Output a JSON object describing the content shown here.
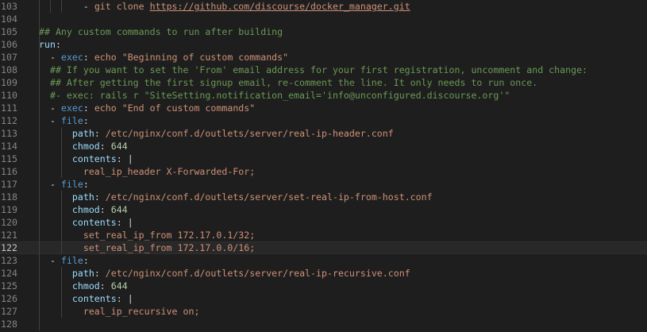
{
  "editor": {
    "lines": [
      {
        "n": "103",
        "parts": [
          [
            "op",
            "        - "
          ],
          [
            "str",
            "git clone "
          ],
          [
            "url",
            "https://github.com/discourse/docker_manager.git"
          ]
        ]
      },
      {
        "n": "104",
        "parts": []
      },
      {
        "n": "105",
        "parts": [
          [
            "cmt",
            "## Any custom commands to run after building"
          ]
        ]
      },
      {
        "n": "106",
        "parts": [
          [
            "prop",
            "run"
          ],
          [
            "op",
            ":"
          ]
        ]
      },
      {
        "n": "107",
        "parts": [
          [
            "op",
            "  - "
          ],
          [
            "key",
            "exec"
          ],
          [
            "op",
            ": "
          ],
          [
            "str",
            "echo \"Beginning of custom commands\""
          ]
        ]
      },
      {
        "n": "108",
        "parts": [
          [
            "cmt",
            "  ## If you want to set the 'From' email address for your first registration, uncomment and change:"
          ]
        ]
      },
      {
        "n": "109",
        "parts": [
          [
            "cmt",
            "  ## After getting the first signup email, re-comment the line. It only needs to run once."
          ]
        ]
      },
      {
        "n": "110",
        "parts": [
          [
            "cmt",
            "  #- exec: rails r \"SiteSetting.notification_email='info@unconfigured.discourse.org'\""
          ]
        ]
      },
      {
        "n": "111",
        "parts": [
          [
            "op",
            "  - "
          ],
          [
            "key",
            "exec"
          ],
          [
            "op",
            ": "
          ],
          [
            "str",
            "echo \"End of custom commands\""
          ]
        ]
      },
      {
        "n": "112",
        "parts": [
          [
            "op",
            "  - "
          ],
          [
            "key",
            "file"
          ],
          [
            "op",
            ":"
          ]
        ]
      },
      {
        "n": "113",
        "parts": [
          [
            "op",
            "      "
          ],
          [
            "prop",
            "path"
          ],
          [
            "op",
            ": "
          ],
          [
            "str",
            "/etc/nginx/conf.d/outlets/server/real-ip-header.conf"
          ]
        ]
      },
      {
        "n": "114",
        "parts": [
          [
            "op",
            "      "
          ],
          [
            "prop",
            "chmod"
          ],
          [
            "op",
            ": "
          ],
          [
            "num",
            "644"
          ]
        ]
      },
      {
        "n": "115",
        "parts": [
          [
            "op",
            "      "
          ],
          [
            "prop",
            "contents"
          ],
          [
            "op",
            ": |"
          ]
        ]
      },
      {
        "n": "116",
        "parts": [
          [
            "str",
            "        real_ip_header X-Forwarded-For;"
          ]
        ]
      },
      {
        "n": "117",
        "parts": [
          [
            "op",
            "  - "
          ],
          [
            "key",
            "file"
          ],
          [
            "op",
            ":"
          ]
        ]
      },
      {
        "n": "118",
        "parts": [
          [
            "op",
            "      "
          ],
          [
            "prop",
            "path"
          ],
          [
            "op",
            ": "
          ],
          [
            "str",
            "/etc/nginx/conf.d/outlets/server/set-real-ip-from-host.conf"
          ]
        ]
      },
      {
        "n": "119",
        "parts": [
          [
            "op",
            "      "
          ],
          [
            "prop",
            "chmod"
          ],
          [
            "op",
            ": "
          ],
          [
            "num",
            "644"
          ]
        ]
      },
      {
        "n": "120",
        "parts": [
          [
            "op",
            "      "
          ],
          [
            "prop",
            "contents"
          ],
          [
            "op",
            ": |"
          ]
        ]
      },
      {
        "n": "121",
        "parts": [
          [
            "str",
            "        set_real_ip_from 172.17.0.1/32;"
          ]
        ]
      },
      {
        "n": "122",
        "parts": [
          [
            "str",
            "        set_real_ip_from 172.17.0.0/16;"
          ]
        ],
        "current": true
      },
      {
        "n": "123",
        "parts": [
          [
            "op",
            "  - "
          ],
          [
            "key",
            "file"
          ],
          [
            "op",
            ":"
          ]
        ]
      },
      {
        "n": "124",
        "parts": [
          [
            "op",
            "      "
          ],
          [
            "prop",
            "path"
          ],
          [
            "op",
            ": "
          ],
          [
            "str",
            "/etc/nginx/conf.d/outlets/server/real-ip-recursive.conf"
          ]
        ]
      },
      {
        "n": "125",
        "parts": [
          [
            "op",
            "      "
          ],
          [
            "prop",
            "chmod"
          ],
          [
            "op",
            ": "
          ],
          [
            "num",
            "644"
          ]
        ]
      },
      {
        "n": "126",
        "parts": [
          [
            "op",
            "      "
          ],
          [
            "prop",
            "contents"
          ],
          [
            "op",
            ": |"
          ]
        ]
      },
      {
        "n": "127",
        "parts": [
          [
            "str",
            "        real_ip_recursive on;"
          ]
        ]
      },
      {
        "n": "128",
        "parts": []
      }
    ]
  }
}
